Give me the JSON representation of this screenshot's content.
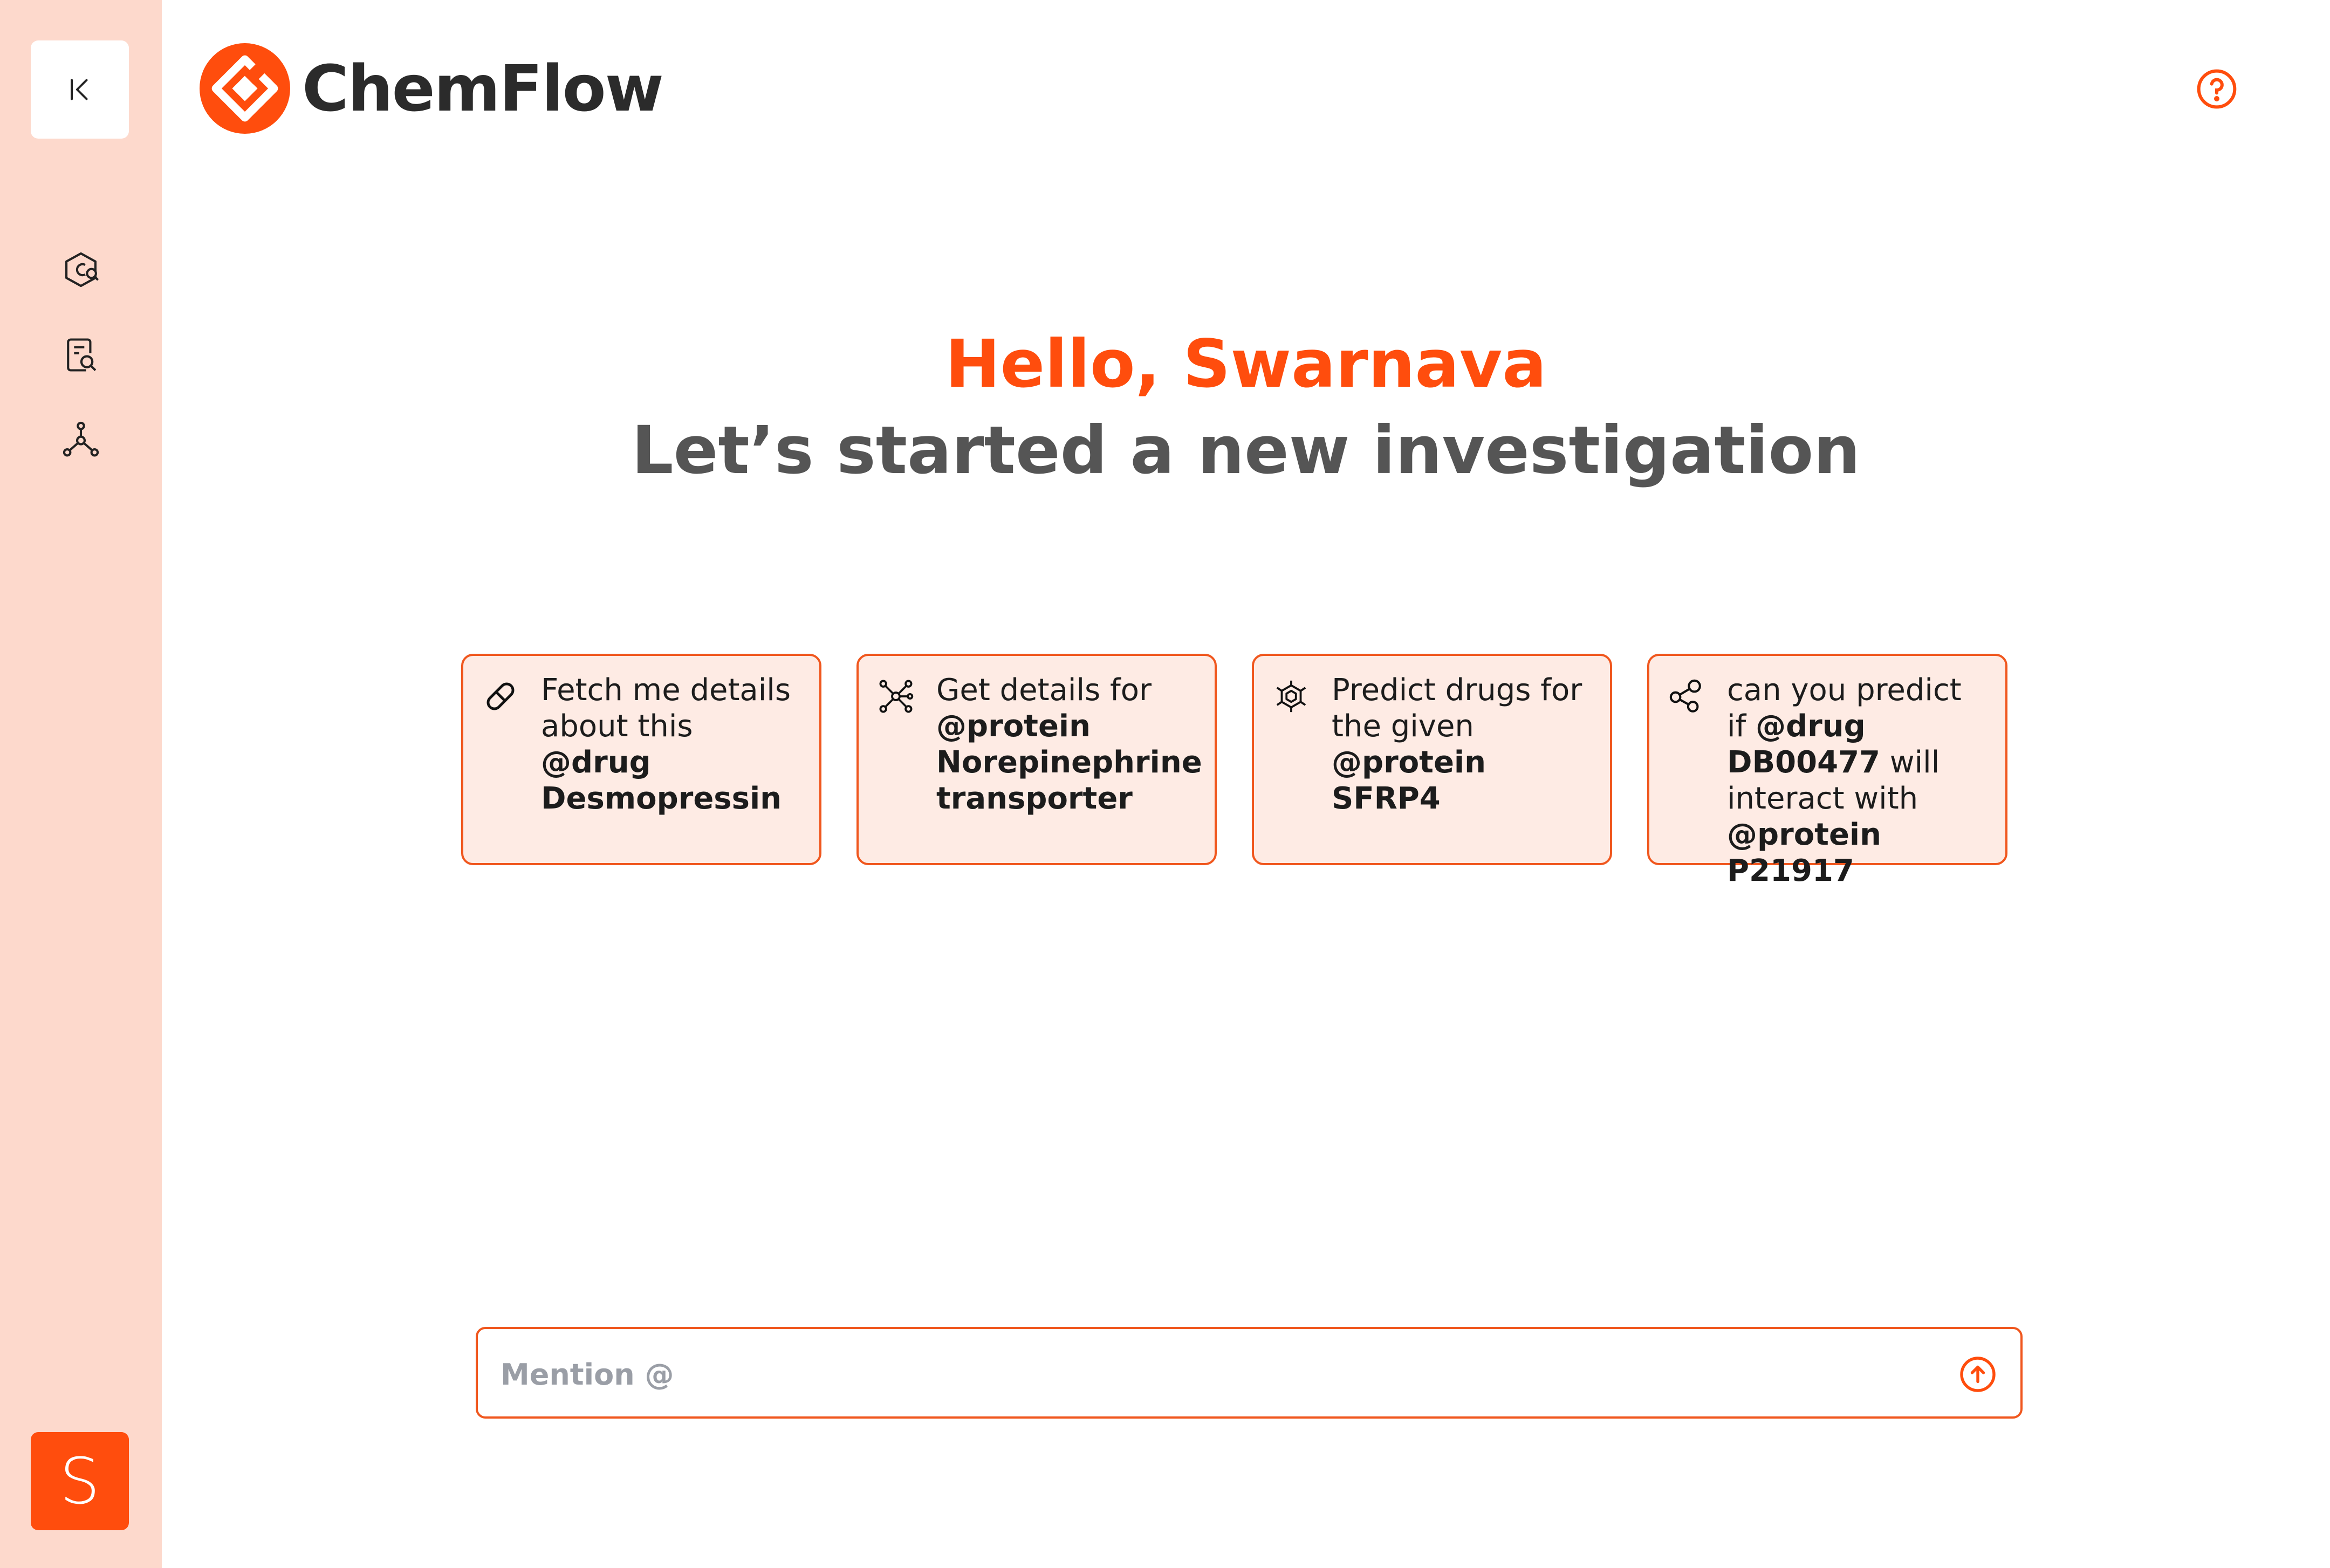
{
  "app": {
    "name": "ChemFlow",
    "brand_color": "#ff4d0d",
    "sidebar_color": "#fdd9cc"
  },
  "sidebar": {
    "collapse_icon": "collapse-left-icon",
    "nav": [
      {
        "id": "molecule-search",
        "icon": "molecule-search-icon"
      },
      {
        "id": "document-search",
        "icon": "document-search-icon"
      },
      {
        "id": "network",
        "icon": "network-graph-icon"
      }
    ],
    "avatar_initial": "S"
  },
  "header": {
    "help_icon": "help-circle-icon"
  },
  "greeting": {
    "hello": "Hello, Swarnava",
    "subtitle": "Let’s started a new investigation"
  },
  "suggestions": [
    {
      "icon": "pill-icon",
      "parts": [
        {
          "text": "Fetch me details about this ",
          "bold": false
        },
        {
          "text": "@drug Desmopressin",
          "bold": true
        }
      ]
    },
    {
      "icon": "molecule-icon",
      "parts": [
        {
          "text": "Get details for ",
          "bold": false
        },
        {
          "text": "@protein Norepinephrine transporter",
          "bold": true
        }
      ]
    },
    {
      "icon": "hexagon-structure-icon",
      "parts": [
        {
          "text": "Predict drugs for the given ",
          "bold": false
        },
        {
          "text": "@protein SFRP4",
          "bold": true
        }
      ]
    },
    {
      "icon": "interaction-icon",
      "parts": [
        {
          "text": "can you predict if ",
          "bold": false
        },
        {
          "text": "@drug DB00477",
          "bold": true
        },
        {
          "text": " will interact with ",
          "bold": false
        },
        {
          "text": "@protein P21917",
          "bold": true
        }
      ]
    }
  ],
  "chat_input": {
    "placeholder": "Mention @",
    "value": "",
    "send_icon": "send-arrow-icon"
  }
}
